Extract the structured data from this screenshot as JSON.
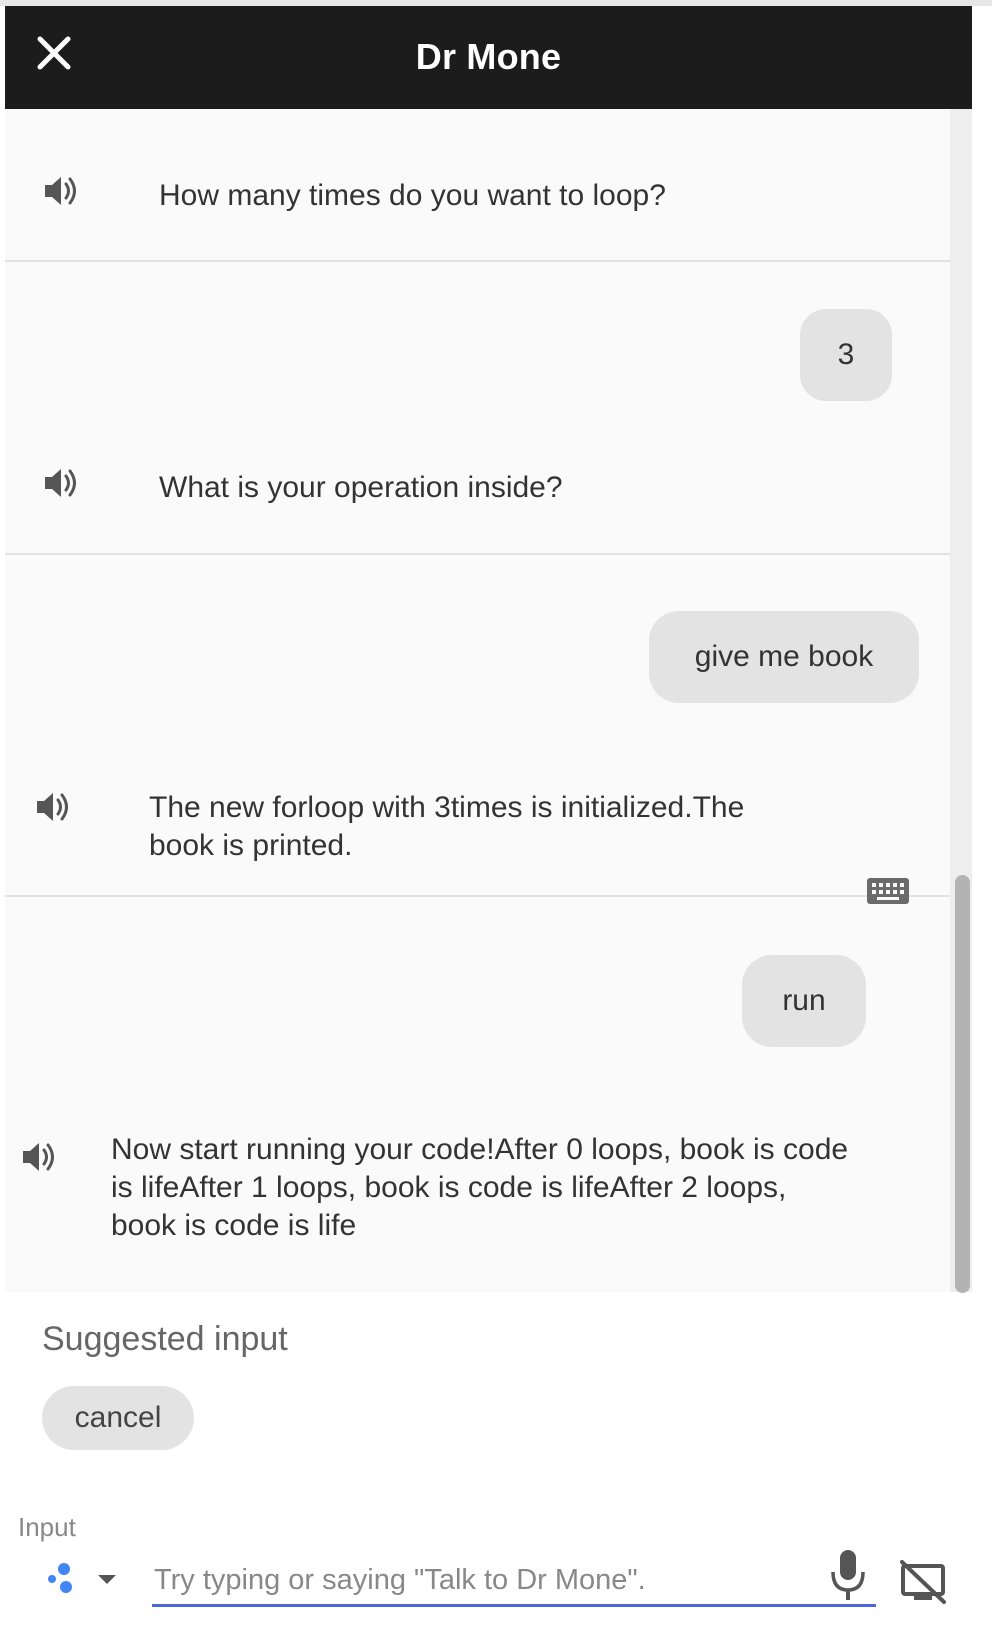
{
  "header": {
    "title": "Dr Mone",
    "close_icon": "close-icon"
  },
  "messages": [
    {
      "sender": "agent",
      "text": "How many times do you want to loop?",
      "icon": "speaker-icon"
    },
    {
      "sender": "user",
      "text": "3"
    },
    {
      "sender": "agent",
      "text": "What is your operation inside?",
      "icon": "speaker-icon"
    },
    {
      "sender": "user",
      "text": "give me book"
    },
    {
      "sender": "agent",
      "text": "The new forloop with 3times is initialized.The book is printed.",
      "icon": "speaker-icon"
    },
    {
      "sender": "user",
      "text": "run",
      "icon": "keyboard-icon"
    },
    {
      "sender": "agent",
      "text": "Now start running your code!After 0 loops, book is code is lifeAfter 1 loops, book is code is lifeAfter 2 loops, book is code is life",
      "icon": "speaker-icon"
    }
  ],
  "suggestions": {
    "label": "Suggested input",
    "chips": [
      "cancel"
    ]
  },
  "input": {
    "label": "Input",
    "placeholder": "Try typing or saying \"Talk to Dr Mone\".",
    "value": ""
  },
  "colors": {
    "header_bg": "#1c1c1c",
    "bubble_bg": "#e3e3e3",
    "input_underline": "#4a68d8",
    "assistant_blue": "#4285f4"
  }
}
